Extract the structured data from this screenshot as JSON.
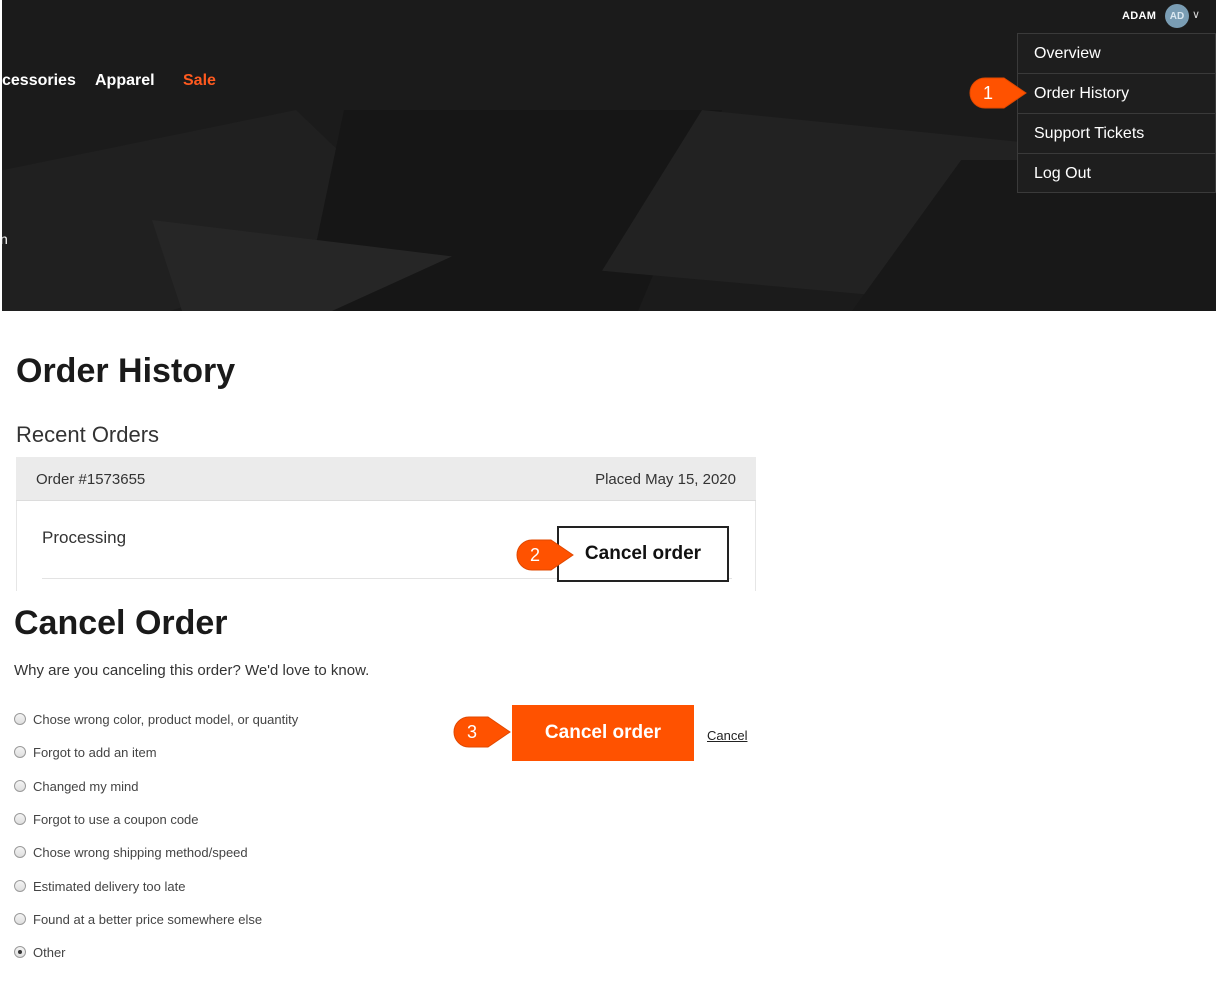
{
  "header": {
    "nav": {
      "accessories_fragment": "cessories",
      "apparel": "Apparel",
      "sale": "Sale"
    },
    "hero_fragment": "n",
    "user": {
      "name": "ADAM",
      "initials": "AD"
    }
  },
  "account_menu": {
    "items": [
      {
        "label": "Overview"
      },
      {
        "label": "Order History"
      },
      {
        "label": "Support Tickets"
      },
      {
        "label": "Log Out"
      }
    ]
  },
  "callouts": {
    "one": "1",
    "two": "2",
    "three": "3"
  },
  "order_history": {
    "title": "Order History",
    "subtitle": "Recent Orders",
    "order": {
      "number": "Order #1573655",
      "placed": "Placed May 15, 2020",
      "status": "Processing",
      "cancel_label": "Cancel order"
    }
  },
  "cancel_order": {
    "title": "Cancel Order",
    "question": "Why are you canceling this order? We'd love to know.",
    "reasons": [
      {
        "label": "Chose wrong color, product model, or quantity",
        "selected": false
      },
      {
        "label": "Forgot to add an item",
        "selected": false
      },
      {
        "label": "Changed my mind",
        "selected": false
      },
      {
        "label": "Forgot to use a coupon code",
        "selected": false
      },
      {
        "label": "Chose wrong shipping method/speed",
        "selected": false
      },
      {
        "label": "Estimated delivery too late",
        "selected": false
      },
      {
        "label": "Found at a better price somewhere else",
        "selected": false
      },
      {
        "label": "Other",
        "selected": true
      }
    ],
    "confirm_label": "Cancel order",
    "cancel_link": "Cancel"
  },
  "colors": {
    "accent": "#ff5200",
    "sale": "#ff5a1f",
    "hero_bg": "#1b1b1b",
    "avatar": "#7a9db4"
  }
}
